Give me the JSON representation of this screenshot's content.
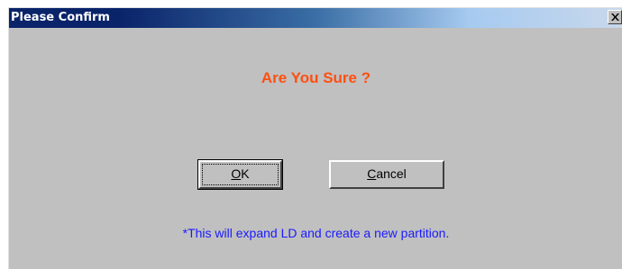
{
  "window": {
    "title": "Please Confirm",
    "close_icon": "close-icon"
  },
  "dialog": {
    "heading": "Are You Sure ?",
    "ok_button": {
      "accelerator": "O",
      "rest": "K"
    },
    "cancel_button": {
      "accelerator": "C",
      "rest": "ancel"
    },
    "note": "*This will expand LD and create a new partition."
  },
  "colors": {
    "titlebar_start": "#0a246a",
    "titlebar_end": "#c8d8ec",
    "heading": "#ff4f10",
    "note": "#1a1aff",
    "face": "#c0c0c0"
  }
}
